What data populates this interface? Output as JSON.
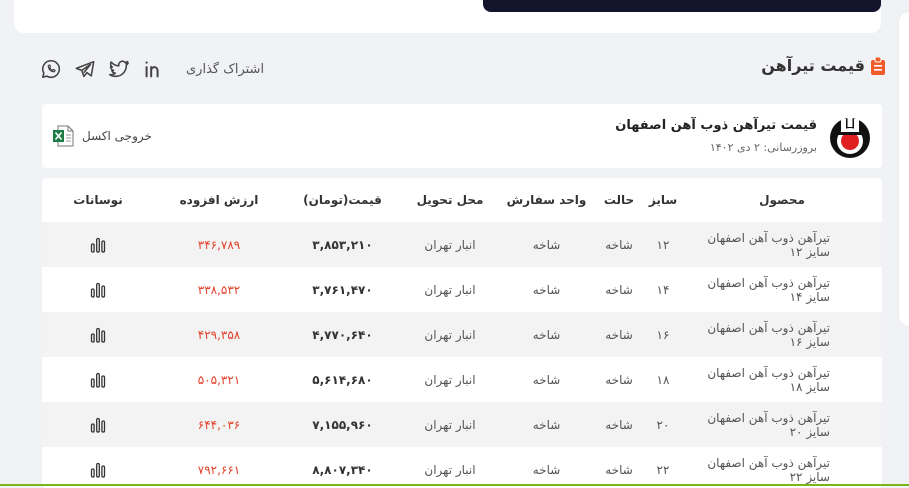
{
  "section": {
    "title": "قیمت تیرآهن"
  },
  "share": {
    "label": "اشتراک گذاری",
    "icons": [
      "linkedin-icon",
      "twitter-icon",
      "telegram-icon",
      "whatsapp-icon"
    ]
  },
  "card": {
    "title": "قیمت تیرآهن ذوب آهن اصفهان",
    "updated": "بروزرسانی: ۲ دی ۱۴۰۲",
    "excel_label": "خروجی اکسل"
  },
  "table": {
    "headers": {
      "product": "محصول",
      "size": "سایز",
      "state": "حالت",
      "unit": "واحد سفارش",
      "place": "محل تحویل",
      "price": "قیمت(تومان)",
      "vat": "ارزش افزوده",
      "chart": "نوسانات"
    },
    "rows": [
      {
        "product": "تیرآهن ذوب آهن اصفهان سایز ۱۲",
        "size": "۱۲",
        "state": "شاخه",
        "unit": "شاخه",
        "place": "انبار تهران",
        "price": "۳,۸۵۳,۲۱۰",
        "vat": "۳۴۶,۷۸۹"
      },
      {
        "product": "تیرآهن ذوب آهن اصفهان سایز ۱۴",
        "size": "۱۴",
        "state": "شاخه",
        "unit": "شاخه",
        "place": "انبار تهران",
        "price": "۳,۷۶۱,۴۷۰",
        "vat": "۳۳۸,۵۳۲"
      },
      {
        "product": "تیرآهن ذوب آهن اصفهان سایز ۱۶",
        "size": "۱۶",
        "state": "شاخه",
        "unit": "شاخه",
        "place": "انبار تهران",
        "price": "۴,۷۷۰,۶۴۰",
        "vat": "۴۲۹,۳۵۸"
      },
      {
        "product": "تیرآهن ذوب آهن اصفهان سایز ۱۸",
        "size": "۱۸",
        "state": "شاخه",
        "unit": "شاخه",
        "place": "انبار تهران",
        "price": "۵,۶۱۴,۶۸۰",
        "vat": "۵۰۵,۳۲۱"
      },
      {
        "product": "تیرآهن ذوب آهن اصفهان سایز ۲۰",
        "size": "۲۰",
        "state": "شاخه",
        "unit": "شاخه",
        "place": "انبار تهران",
        "price": "۷,۱۵۵,۹۶۰",
        "vat": "۶۴۴,۰۳۶"
      },
      {
        "product": "تیرآهن ذوب آهن اصفهان سایز ۲۲",
        "size": "۲۲",
        "state": "شاخه",
        "unit": "شاخه",
        "place": "انبار تهران",
        "price": "۸,۸۰۷,۳۴۰",
        "vat": "۷۹۲,۶۶۱"
      }
    ]
  },
  "colors": {
    "accent": "#e4402a",
    "title_icon": "#ef5b2a",
    "dark_bar": "#14142c",
    "green_line": "#7cb518"
  }
}
